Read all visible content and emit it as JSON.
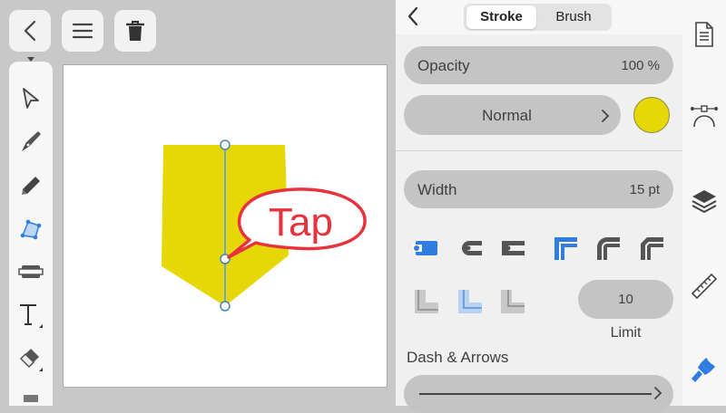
{
  "panel": {
    "tabs": [
      {
        "label": "Stroke",
        "selected": true
      },
      {
        "label": "Brush",
        "selected": false
      }
    ],
    "opacity": {
      "label": "Opacity",
      "value": "100 %"
    },
    "blend_mode": {
      "label": "Normal"
    },
    "stroke_color": "#e5d806",
    "width": {
      "label": "Width",
      "value": "15 pt"
    },
    "miter_limit": {
      "value": "10",
      "label": "Limit"
    },
    "dash_arrows": {
      "label": "Dash & Arrows"
    }
  },
  "canvas": {
    "callout_text": "Tap",
    "shape_color": "#e5d806",
    "callout_color": "#e8323c"
  },
  "toolbar": {
    "active_tool": "shape-builder-tool"
  }
}
